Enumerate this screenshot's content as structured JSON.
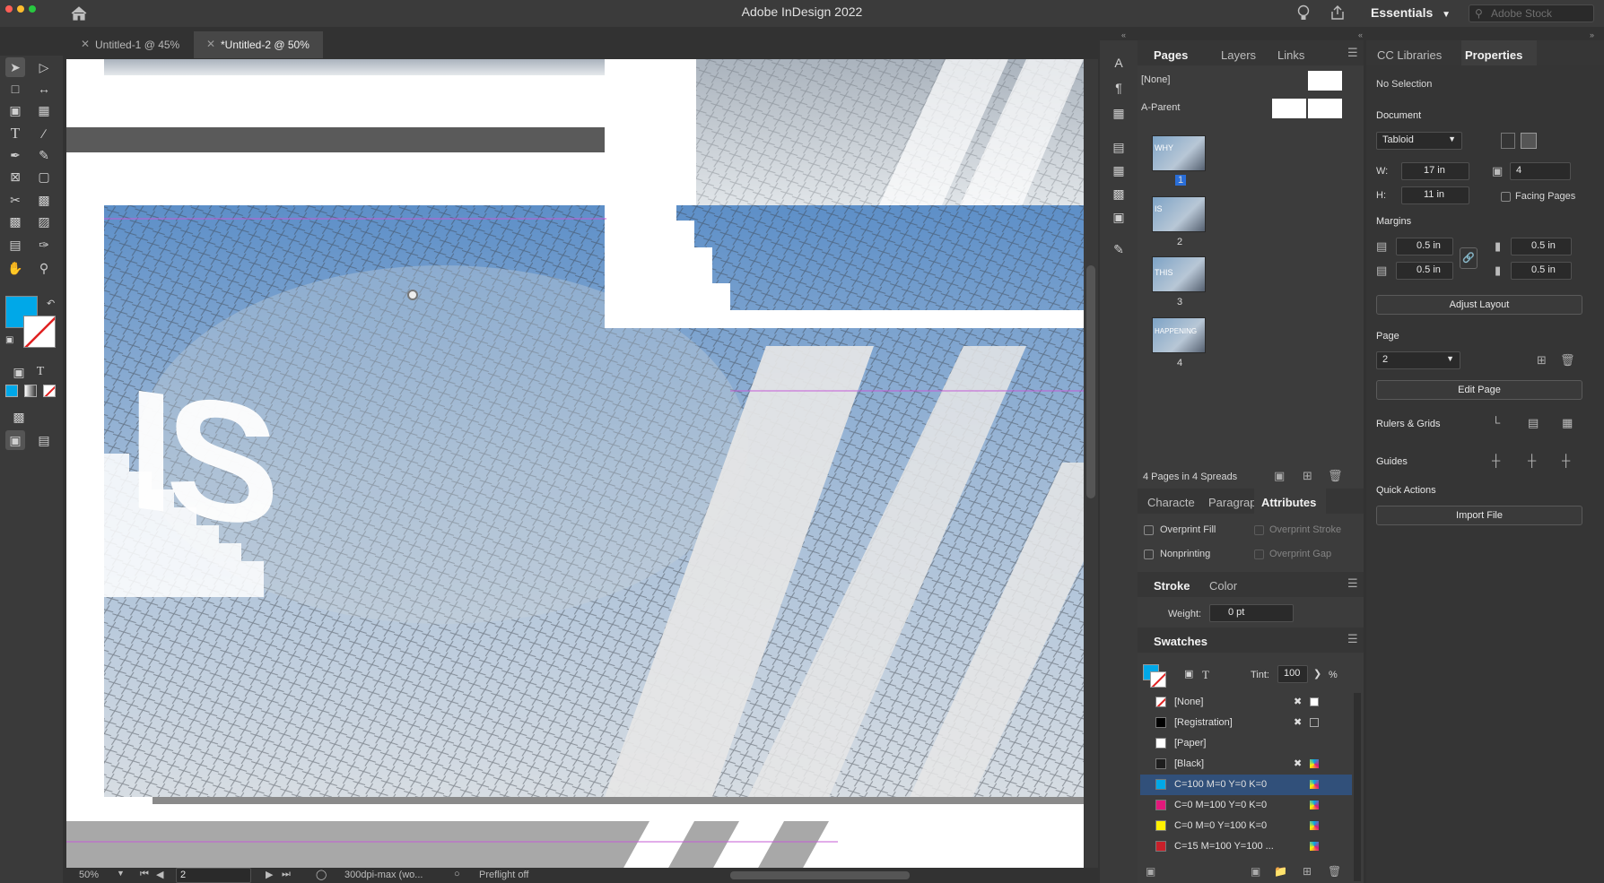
{
  "app": {
    "title": "Adobe InDesign 2022",
    "workspace": "Essentials",
    "stock_placeholder": "Adobe Stock"
  },
  "tabs": [
    {
      "label": "Untitled-1 @ 45%"
    },
    {
      "label": "*Untitled-2 @ 50%"
    }
  ],
  "canvas": {
    "text_is": "IS"
  },
  "statusbar": {
    "zoom": "50%",
    "page": "2",
    "profile": "300dpi-max (wo...",
    "preflight": "Preflight off"
  },
  "pages_panel": {
    "tabs": [
      "Pages",
      "Layers",
      "Links"
    ],
    "none_label": "[None]",
    "parent_label": "A-Parent",
    "pages": [
      {
        "num": "1",
        "label": "WHY"
      },
      {
        "num": "2",
        "label": "IS"
      },
      {
        "num": "3",
        "label": "THIS"
      },
      {
        "num": "4",
        "label": "HAPPENING"
      }
    ],
    "summary": "4 Pages in 4 Spreads"
  },
  "attributes_panel": {
    "tabs": [
      "Characte",
      "Paragrap",
      "Attributes"
    ],
    "overprint_fill": "Overprint Fill",
    "overprint_stroke": "Overprint Stroke",
    "nonprinting": "Nonprinting",
    "overprint_gap": "Overprint Gap"
  },
  "stroke_panel": {
    "tabs": [
      "Stroke",
      "Color"
    ],
    "weight_label": "Weight:",
    "weight_value": "0 pt"
  },
  "swatches_panel": {
    "title": "Swatches",
    "tint_label": "Tint:",
    "tint_value": "100",
    "tint_unit": "%",
    "items": [
      {
        "name": "[None]",
        "color": "#ffffff"
      },
      {
        "name": "[Registration]",
        "color": "#000000"
      },
      {
        "name": "[Paper]",
        "color": "#ffffff"
      },
      {
        "name": "[Black]",
        "color": "#1e1e1e"
      },
      {
        "name": "C=100 M=0 Y=0 K=0",
        "color": "#00a8e8"
      },
      {
        "name": "C=0 M=100 Y=0 K=0",
        "color": "#e2187b"
      },
      {
        "name": "C=0 M=0 Y=100 K=0",
        "color": "#fff100"
      },
      {
        "name": "C=15 M=100 Y=100 ...",
        "color": "#c8202a"
      }
    ]
  },
  "properties_panel": {
    "tabs": [
      "CC Libraries",
      "Properties"
    ],
    "selection": "No Selection",
    "document_label": "Document",
    "preset": "Tabloid",
    "w_label": "W:",
    "width": "17 in",
    "h_label": "H:",
    "height": "11 in",
    "pages_count": "4",
    "facing_pages": "Facing Pages",
    "margins_label": "Margins",
    "margin_top": "0.5 in",
    "margin_bottom": "0.5 in",
    "margin_left": "0.5 in",
    "margin_right": "0.5 in",
    "adjust_layout": "Adjust Layout",
    "page_label": "Page",
    "page_value": "2",
    "edit_page": "Edit Page",
    "rulers_grids": "Rulers & Grids",
    "guides": "Guides",
    "quick_actions": "Quick Actions",
    "import_file": "Import File"
  },
  "colors": {
    "fill": "#00a8e8",
    "accent": "#00a8e8"
  }
}
